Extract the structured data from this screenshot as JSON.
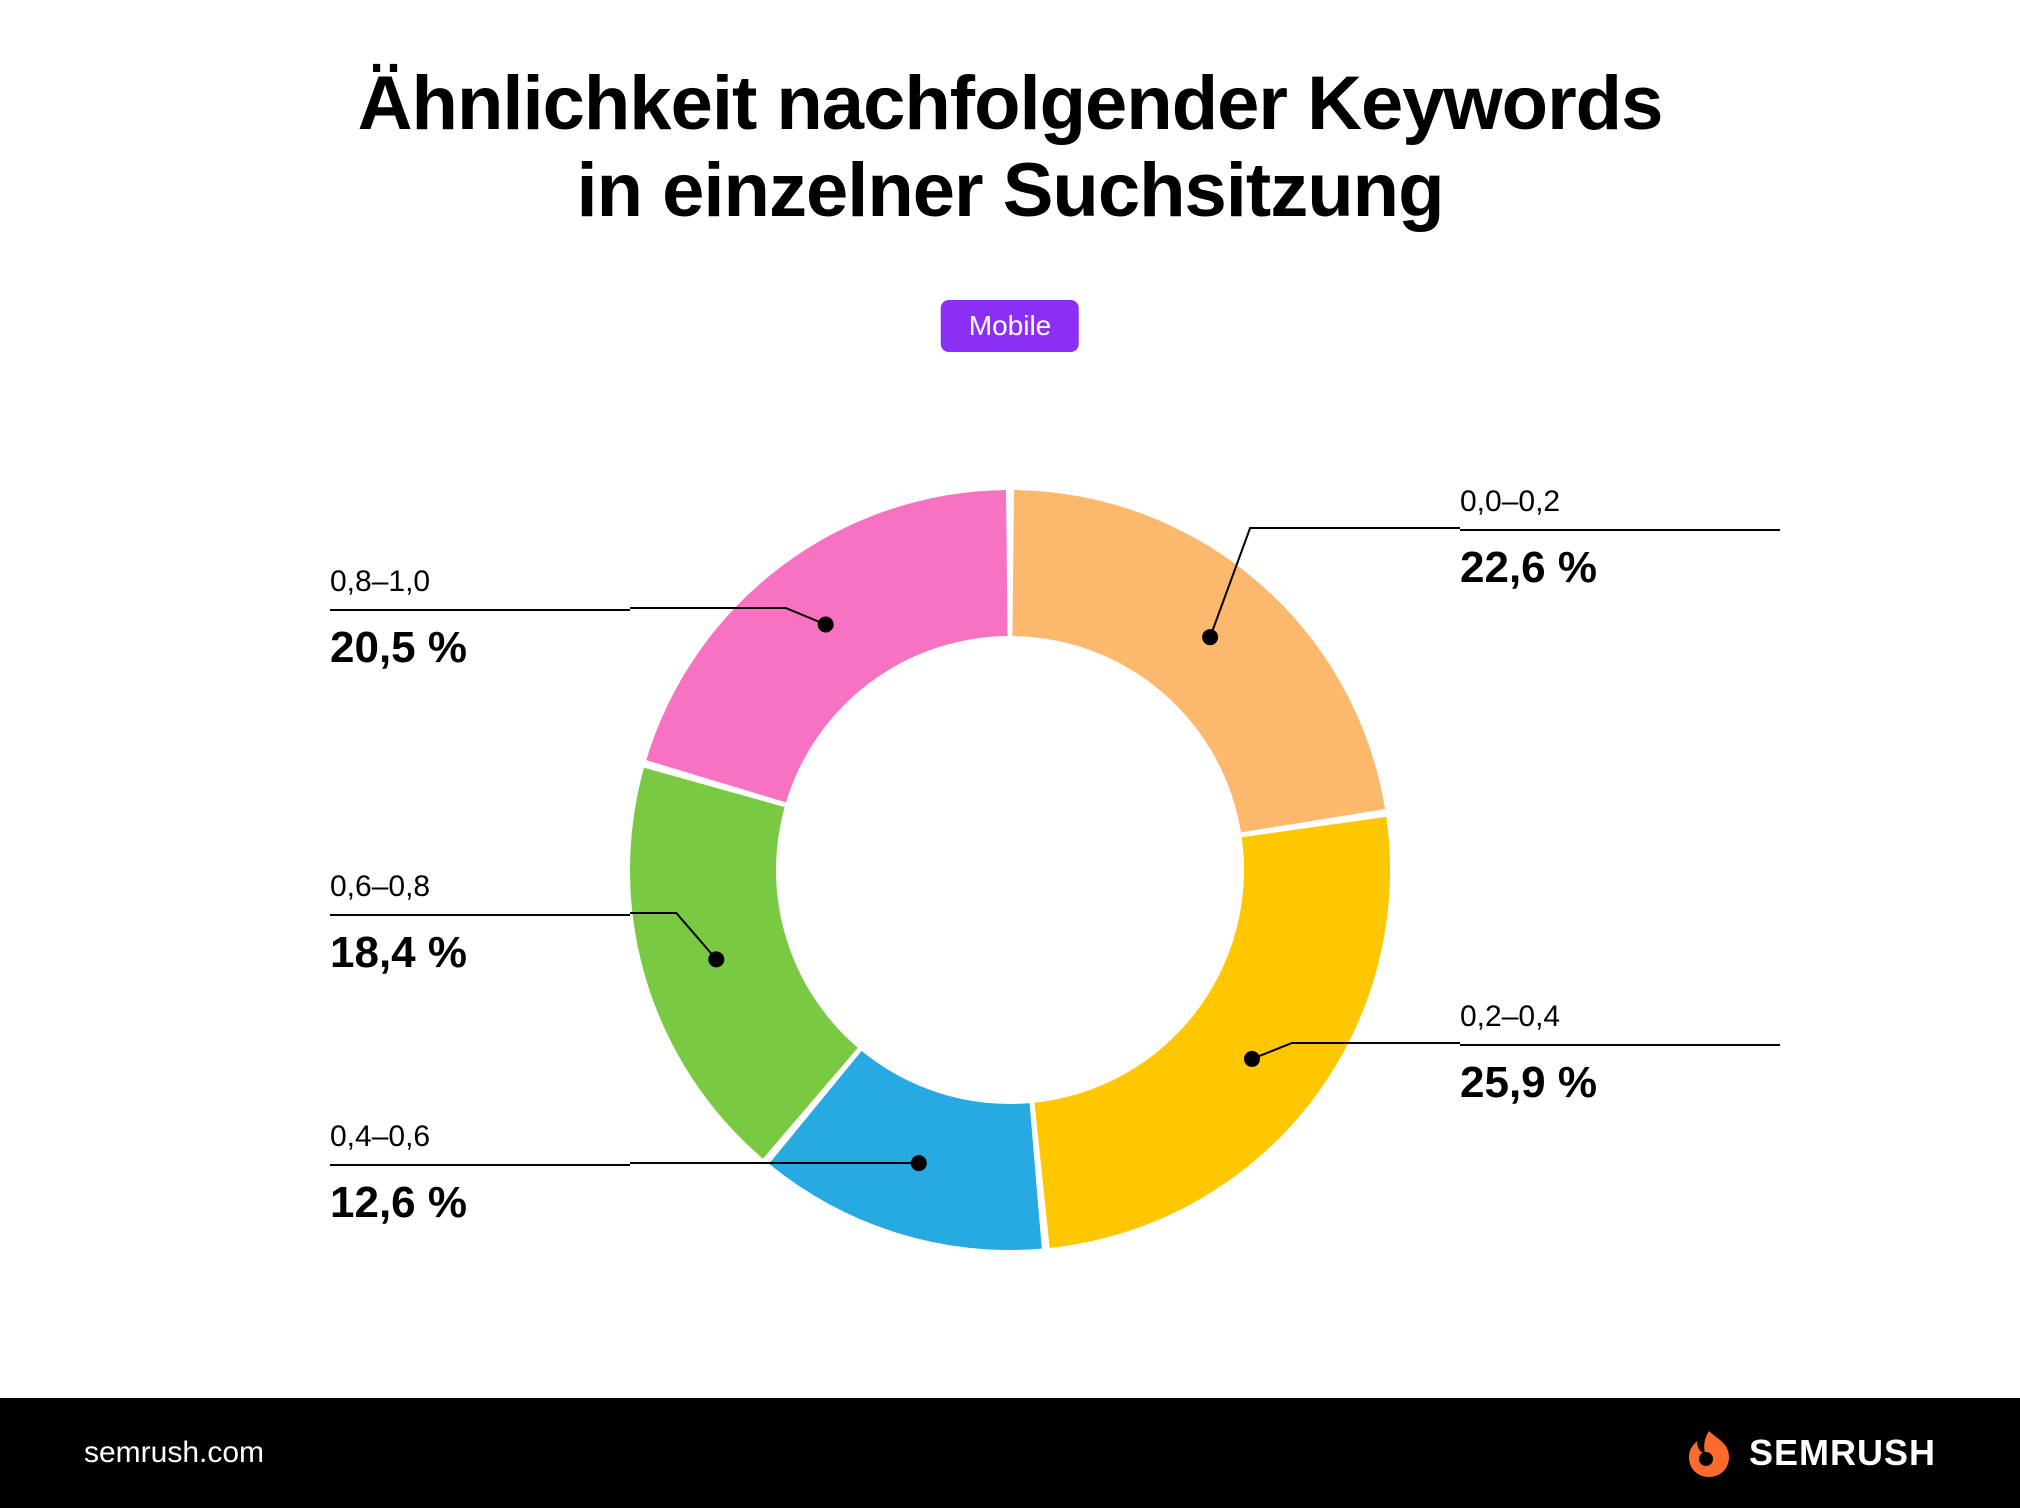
{
  "title_line1": "Ähnlichkeit nachfolgender Keywords",
  "title_line2": "in einzelner Suchsitzung",
  "badge": "Mobile",
  "footer_site": "semrush.com",
  "brand_name": "SEMRUSH",
  "colors": {
    "badge": "#8b2ff5",
    "brand_accent": "#ff6b2c"
  },
  "chart_data": {
    "type": "pie",
    "title": "Ähnlichkeit nachfolgender Keywords in einzelner Suchsitzung",
    "subtype": "donut",
    "series_name": "Mobile",
    "slices": [
      {
        "label": "0,0–0,2",
        "value": 22.6,
        "display": "22,6 %",
        "color": "#fcb86d"
      },
      {
        "label": "0,2–0,4",
        "value": 25.9,
        "display": "25,9 %",
        "color": "#ffc700"
      },
      {
        "label": "0,4–0,6",
        "value": 12.6,
        "display": "12,6 %",
        "color": "#27aae1"
      },
      {
        "label": "0,6–0,8",
        "value": 18.4,
        "display": "18,4 %",
        "color": "#7ac943"
      },
      {
        "label": "0,8–1,0",
        "value": 20.5,
        "display": "20,5 %",
        "color": "#f772c1"
      }
    ]
  }
}
